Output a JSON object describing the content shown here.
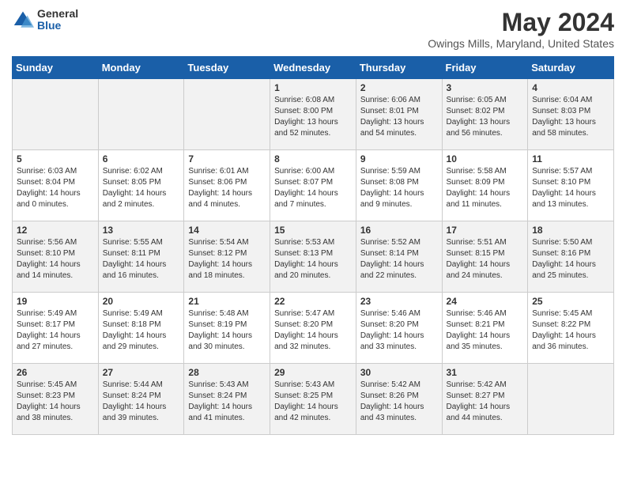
{
  "logo": {
    "general": "General",
    "blue": "Blue"
  },
  "title": "May 2024",
  "subtitle": "Owings Mills, Maryland, United States",
  "days_of_week": [
    "Sunday",
    "Monday",
    "Tuesday",
    "Wednesday",
    "Thursday",
    "Friday",
    "Saturday"
  ],
  "weeks": [
    [
      {
        "num": "",
        "info": ""
      },
      {
        "num": "",
        "info": ""
      },
      {
        "num": "",
        "info": ""
      },
      {
        "num": "1",
        "info": "Sunrise: 6:08 AM\nSunset: 8:00 PM\nDaylight: 13 hours and 52 minutes."
      },
      {
        "num": "2",
        "info": "Sunrise: 6:06 AM\nSunset: 8:01 PM\nDaylight: 13 hours and 54 minutes."
      },
      {
        "num": "3",
        "info": "Sunrise: 6:05 AM\nSunset: 8:02 PM\nDaylight: 13 hours and 56 minutes."
      },
      {
        "num": "4",
        "info": "Sunrise: 6:04 AM\nSunset: 8:03 PM\nDaylight: 13 hours and 58 minutes."
      }
    ],
    [
      {
        "num": "5",
        "info": "Sunrise: 6:03 AM\nSunset: 8:04 PM\nDaylight: 14 hours and 0 minutes."
      },
      {
        "num": "6",
        "info": "Sunrise: 6:02 AM\nSunset: 8:05 PM\nDaylight: 14 hours and 2 minutes."
      },
      {
        "num": "7",
        "info": "Sunrise: 6:01 AM\nSunset: 8:06 PM\nDaylight: 14 hours and 4 minutes."
      },
      {
        "num": "8",
        "info": "Sunrise: 6:00 AM\nSunset: 8:07 PM\nDaylight: 14 hours and 7 minutes."
      },
      {
        "num": "9",
        "info": "Sunrise: 5:59 AM\nSunset: 8:08 PM\nDaylight: 14 hours and 9 minutes."
      },
      {
        "num": "10",
        "info": "Sunrise: 5:58 AM\nSunset: 8:09 PM\nDaylight: 14 hours and 11 minutes."
      },
      {
        "num": "11",
        "info": "Sunrise: 5:57 AM\nSunset: 8:10 PM\nDaylight: 14 hours and 13 minutes."
      }
    ],
    [
      {
        "num": "12",
        "info": "Sunrise: 5:56 AM\nSunset: 8:10 PM\nDaylight: 14 hours and 14 minutes."
      },
      {
        "num": "13",
        "info": "Sunrise: 5:55 AM\nSunset: 8:11 PM\nDaylight: 14 hours and 16 minutes."
      },
      {
        "num": "14",
        "info": "Sunrise: 5:54 AM\nSunset: 8:12 PM\nDaylight: 14 hours and 18 minutes."
      },
      {
        "num": "15",
        "info": "Sunrise: 5:53 AM\nSunset: 8:13 PM\nDaylight: 14 hours and 20 minutes."
      },
      {
        "num": "16",
        "info": "Sunrise: 5:52 AM\nSunset: 8:14 PM\nDaylight: 14 hours and 22 minutes."
      },
      {
        "num": "17",
        "info": "Sunrise: 5:51 AM\nSunset: 8:15 PM\nDaylight: 14 hours and 24 minutes."
      },
      {
        "num": "18",
        "info": "Sunrise: 5:50 AM\nSunset: 8:16 PM\nDaylight: 14 hours and 25 minutes."
      }
    ],
    [
      {
        "num": "19",
        "info": "Sunrise: 5:49 AM\nSunset: 8:17 PM\nDaylight: 14 hours and 27 minutes."
      },
      {
        "num": "20",
        "info": "Sunrise: 5:49 AM\nSunset: 8:18 PM\nDaylight: 14 hours and 29 minutes."
      },
      {
        "num": "21",
        "info": "Sunrise: 5:48 AM\nSunset: 8:19 PM\nDaylight: 14 hours and 30 minutes."
      },
      {
        "num": "22",
        "info": "Sunrise: 5:47 AM\nSunset: 8:20 PM\nDaylight: 14 hours and 32 minutes."
      },
      {
        "num": "23",
        "info": "Sunrise: 5:46 AM\nSunset: 8:20 PM\nDaylight: 14 hours and 33 minutes."
      },
      {
        "num": "24",
        "info": "Sunrise: 5:46 AM\nSunset: 8:21 PM\nDaylight: 14 hours and 35 minutes."
      },
      {
        "num": "25",
        "info": "Sunrise: 5:45 AM\nSunset: 8:22 PM\nDaylight: 14 hours and 36 minutes."
      }
    ],
    [
      {
        "num": "26",
        "info": "Sunrise: 5:45 AM\nSunset: 8:23 PM\nDaylight: 14 hours and 38 minutes."
      },
      {
        "num": "27",
        "info": "Sunrise: 5:44 AM\nSunset: 8:24 PM\nDaylight: 14 hours and 39 minutes."
      },
      {
        "num": "28",
        "info": "Sunrise: 5:43 AM\nSunset: 8:24 PM\nDaylight: 14 hours and 41 minutes."
      },
      {
        "num": "29",
        "info": "Sunrise: 5:43 AM\nSunset: 8:25 PM\nDaylight: 14 hours and 42 minutes."
      },
      {
        "num": "30",
        "info": "Sunrise: 5:42 AM\nSunset: 8:26 PM\nDaylight: 14 hours and 43 minutes."
      },
      {
        "num": "31",
        "info": "Sunrise: 5:42 AM\nSunset: 8:27 PM\nDaylight: 14 hours and 44 minutes."
      },
      {
        "num": "",
        "info": ""
      }
    ]
  ]
}
